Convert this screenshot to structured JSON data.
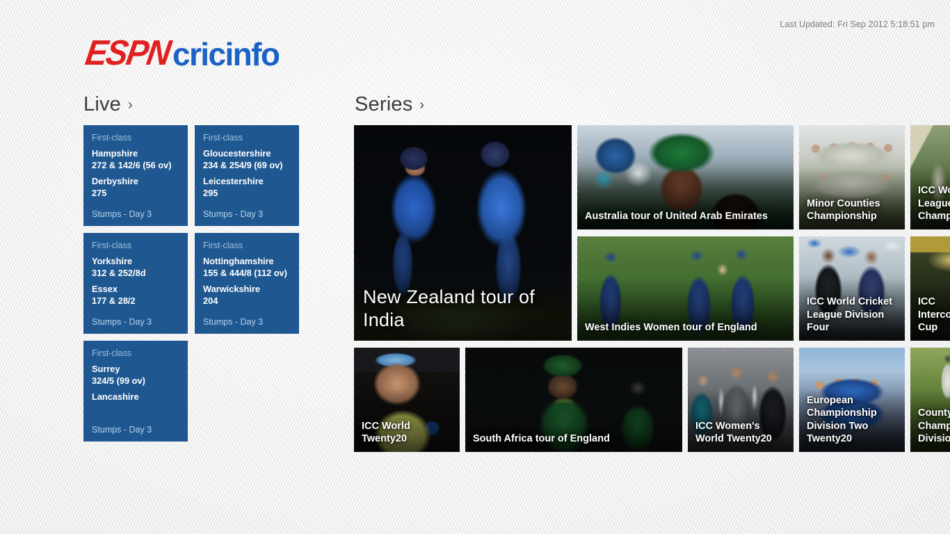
{
  "header": {
    "last_updated": "Last Updated: Fri Sep 2012 5:18:51 pm",
    "logo_espn": "ESPN",
    "logo_cricinfo": "cricinfo"
  },
  "live": {
    "heading": "Live",
    "chevron": "›",
    "matches": [
      {
        "format": "First-class",
        "team1": "Hampshire",
        "score1": "272 & 142/6 (56 ov)",
        "team2": "Derbyshire",
        "score2": "275",
        "status": "Stumps - Day 3"
      },
      {
        "format": "First-class",
        "team1": "Gloucestershire",
        "score1": "234 & 254/9 (69 ov)",
        "team2": "Leicestershire",
        "score2": "295",
        "status": "Stumps - Day 3"
      },
      {
        "format": "First-class",
        "team1": "Yorkshire",
        "score1": "312 & 252/8d",
        "team2": "Essex",
        "score2": "177 & 28/2",
        "status": "Stumps - Day 3"
      },
      {
        "format": "First-class",
        "team1": "Nottinghamshire",
        "score1": "155 & 444/8 (112 ov)",
        "team2": "Warwickshire",
        "score2": "204",
        "status": "Stumps - Day 3"
      },
      {
        "format": "First-class",
        "team1": "Surrey",
        "score1": "324/5 (99 ov)",
        "team2": "Lancashire",
        "score2": "",
        "status": "Stumps - Day 3"
      }
    ]
  },
  "series": {
    "heading": "Series",
    "chevron": "›",
    "tiles": [
      {
        "id": "tile-nz",
        "caption": "New Zealand tour of\nIndia"
      },
      {
        "id": "tile-aus",
        "caption": "Australia tour of United Arab Emirates"
      },
      {
        "id": "tile-wiw",
        "caption": "West Indies Women tour of England"
      },
      {
        "id": "tile-minor",
        "caption": "Minor Counties\nChampionship"
      },
      {
        "id": "tile-iccwclc",
        "caption": "ICC World Cricket\nLeague\nChampionship"
      },
      {
        "id": "tile-iccwcl4",
        "caption": "ICC World Cricket\nLeague Division\nFour"
      },
      {
        "id": "tile-iccic",
        "caption": "ICC\nIntercontinental\nCup"
      },
      {
        "id": "tile-wt20",
        "caption": "ICC World\nTwenty20"
      },
      {
        "id": "tile-sa",
        "caption": "South Africa tour of England"
      },
      {
        "id": "tile-iccwwt20",
        "caption": "ICC Women's\nWorld Twenty20"
      },
      {
        "id": "tile-euro",
        "caption": "European\nChampionship\nDivision Two\nTwenty20"
      },
      {
        "id": "tile-county",
        "caption": "County\nChampionship\nDivision One"
      }
    ]
  },
  "colors": {
    "tile_blue": "#1f5891",
    "espn_red": "#e02020",
    "cricinfo_blue": "#1a62c4",
    "background": "#e8e8e8"
  }
}
